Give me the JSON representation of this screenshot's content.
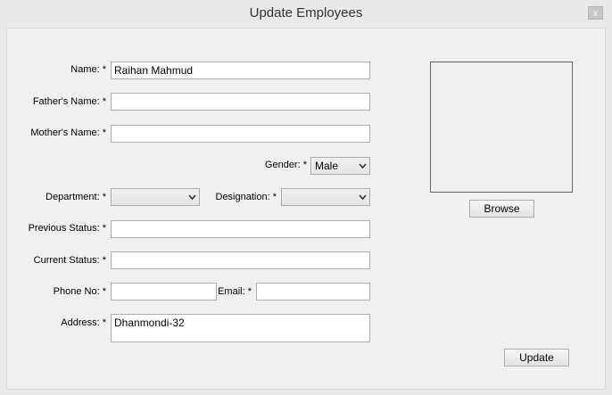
{
  "window": {
    "title": "Update Employees",
    "close_label": "x"
  },
  "form": {
    "name_label": "Name: *",
    "name_value": "Raihan Mahmud",
    "fathers_name_label": "Father's Name: *",
    "fathers_name_value": "",
    "mothers_name_label": "Mother's Name: *",
    "mothers_name_value": "",
    "gender_label": "Gender: *",
    "gender_value": "Male",
    "department_label": "Department: *",
    "department_value": "",
    "designation_label": "Designation: *",
    "designation_value": "",
    "previous_status_label": "Previous Status: *",
    "previous_status_value": "",
    "current_status_label": "Current Status: *",
    "current_status_value": "",
    "phone_label": "Phone No: *",
    "phone_value": "",
    "email_label": "Email: *",
    "email_value": "",
    "address_label": "Address: *",
    "address_value": "Dhanmondi-32"
  },
  "buttons": {
    "browse": "Browse",
    "update": "Update"
  }
}
